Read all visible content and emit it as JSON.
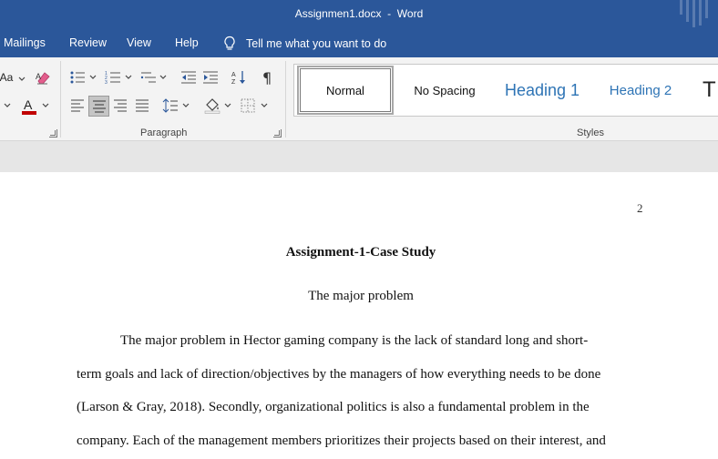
{
  "window": {
    "file_name": "Assignmen1.docx",
    "separator": "  -  ",
    "app_name": "Word"
  },
  "menu": {
    "tabs": [
      "Mailings",
      "Review",
      "View",
      "Help"
    ],
    "tell_me": "Tell me what you want to do"
  },
  "ribbon": {
    "partial_left_label": "Aa",
    "paragraph_label": "Paragraph",
    "styles_label": "Styles",
    "styles": [
      "Normal",
      "No Spacing",
      "Heading 1",
      "Heading 2",
      "T"
    ],
    "selected_style": "Normal",
    "colors": {
      "heading": "#2e74b5",
      "font_color_bar": "#c00000",
      "eraser_pink": "#e35d8c"
    }
  },
  "document": {
    "page_number": "2",
    "title": "Assignment-1-Case Study",
    "subtitle": "The major problem",
    "lines": [
      "The major problem in Hector gaming company is the lack of standard long and short-",
      "term goals and lack of direction/objectives by the managers of how everything needs to be done",
      "(Larson & Gray, 2018).  Secondly, organizational politics is also a fundamental problem in the",
      "company. Each of the management members prioritizes their projects based on their interest, and"
    ]
  }
}
